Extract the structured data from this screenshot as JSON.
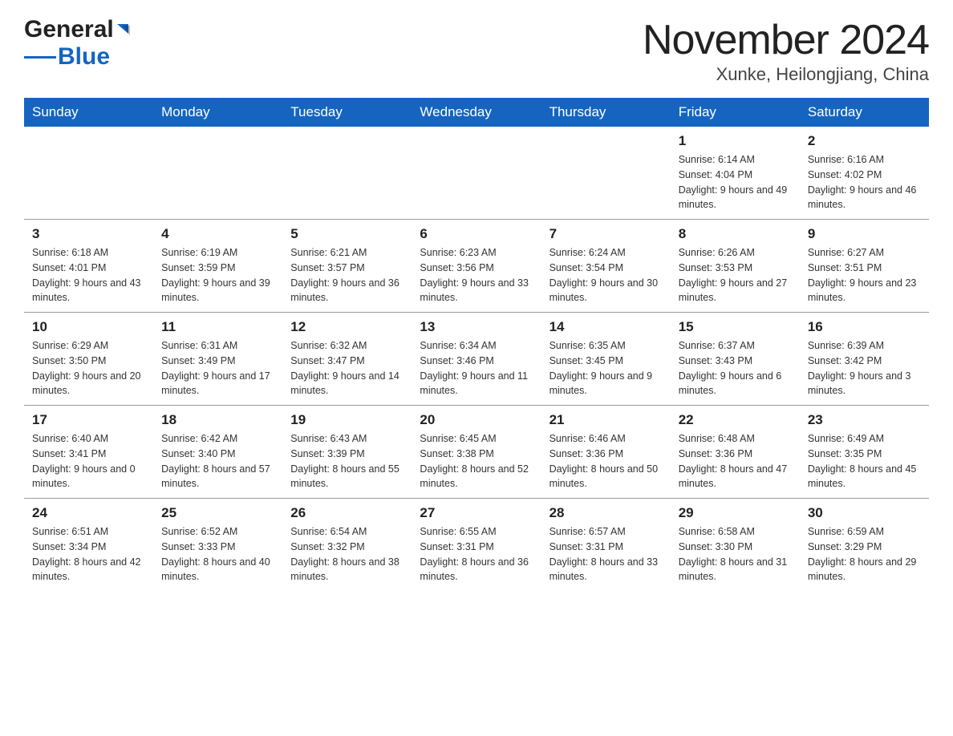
{
  "header": {
    "logo_general": "General",
    "logo_blue": "Blue",
    "title": "November 2024",
    "subtitle": "Xunke, Heilongjiang, China"
  },
  "days_of_week": [
    "Sunday",
    "Monday",
    "Tuesday",
    "Wednesday",
    "Thursday",
    "Friday",
    "Saturday"
  ],
  "weeks": [
    {
      "days": [
        {
          "num": "",
          "info": ""
        },
        {
          "num": "",
          "info": ""
        },
        {
          "num": "",
          "info": ""
        },
        {
          "num": "",
          "info": ""
        },
        {
          "num": "",
          "info": ""
        },
        {
          "num": "1",
          "info": "Sunrise: 6:14 AM\nSunset: 4:04 PM\nDaylight: 9 hours and 49 minutes."
        },
        {
          "num": "2",
          "info": "Sunrise: 6:16 AM\nSunset: 4:02 PM\nDaylight: 9 hours and 46 minutes."
        }
      ]
    },
    {
      "days": [
        {
          "num": "3",
          "info": "Sunrise: 6:18 AM\nSunset: 4:01 PM\nDaylight: 9 hours and 43 minutes."
        },
        {
          "num": "4",
          "info": "Sunrise: 6:19 AM\nSunset: 3:59 PM\nDaylight: 9 hours and 39 minutes."
        },
        {
          "num": "5",
          "info": "Sunrise: 6:21 AM\nSunset: 3:57 PM\nDaylight: 9 hours and 36 minutes."
        },
        {
          "num": "6",
          "info": "Sunrise: 6:23 AM\nSunset: 3:56 PM\nDaylight: 9 hours and 33 minutes."
        },
        {
          "num": "7",
          "info": "Sunrise: 6:24 AM\nSunset: 3:54 PM\nDaylight: 9 hours and 30 minutes."
        },
        {
          "num": "8",
          "info": "Sunrise: 6:26 AM\nSunset: 3:53 PM\nDaylight: 9 hours and 27 minutes."
        },
        {
          "num": "9",
          "info": "Sunrise: 6:27 AM\nSunset: 3:51 PM\nDaylight: 9 hours and 23 minutes."
        }
      ]
    },
    {
      "days": [
        {
          "num": "10",
          "info": "Sunrise: 6:29 AM\nSunset: 3:50 PM\nDaylight: 9 hours and 20 minutes."
        },
        {
          "num": "11",
          "info": "Sunrise: 6:31 AM\nSunset: 3:49 PM\nDaylight: 9 hours and 17 minutes."
        },
        {
          "num": "12",
          "info": "Sunrise: 6:32 AM\nSunset: 3:47 PM\nDaylight: 9 hours and 14 minutes."
        },
        {
          "num": "13",
          "info": "Sunrise: 6:34 AM\nSunset: 3:46 PM\nDaylight: 9 hours and 11 minutes."
        },
        {
          "num": "14",
          "info": "Sunrise: 6:35 AM\nSunset: 3:45 PM\nDaylight: 9 hours and 9 minutes."
        },
        {
          "num": "15",
          "info": "Sunrise: 6:37 AM\nSunset: 3:43 PM\nDaylight: 9 hours and 6 minutes."
        },
        {
          "num": "16",
          "info": "Sunrise: 6:39 AM\nSunset: 3:42 PM\nDaylight: 9 hours and 3 minutes."
        }
      ]
    },
    {
      "days": [
        {
          "num": "17",
          "info": "Sunrise: 6:40 AM\nSunset: 3:41 PM\nDaylight: 9 hours and 0 minutes."
        },
        {
          "num": "18",
          "info": "Sunrise: 6:42 AM\nSunset: 3:40 PM\nDaylight: 8 hours and 57 minutes."
        },
        {
          "num": "19",
          "info": "Sunrise: 6:43 AM\nSunset: 3:39 PM\nDaylight: 8 hours and 55 minutes."
        },
        {
          "num": "20",
          "info": "Sunrise: 6:45 AM\nSunset: 3:38 PM\nDaylight: 8 hours and 52 minutes."
        },
        {
          "num": "21",
          "info": "Sunrise: 6:46 AM\nSunset: 3:36 PM\nDaylight: 8 hours and 50 minutes."
        },
        {
          "num": "22",
          "info": "Sunrise: 6:48 AM\nSunset: 3:36 PM\nDaylight: 8 hours and 47 minutes."
        },
        {
          "num": "23",
          "info": "Sunrise: 6:49 AM\nSunset: 3:35 PM\nDaylight: 8 hours and 45 minutes."
        }
      ]
    },
    {
      "days": [
        {
          "num": "24",
          "info": "Sunrise: 6:51 AM\nSunset: 3:34 PM\nDaylight: 8 hours and 42 minutes."
        },
        {
          "num": "25",
          "info": "Sunrise: 6:52 AM\nSunset: 3:33 PM\nDaylight: 8 hours and 40 minutes."
        },
        {
          "num": "26",
          "info": "Sunrise: 6:54 AM\nSunset: 3:32 PM\nDaylight: 8 hours and 38 minutes."
        },
        {
          "num": "27",
          "info": "Sunrise: 6:55 AM\nSunset: 3:31 PM\nDaylight: 8 hours and 36 minutes."
        },
        {
          "num": "28",
          "info": "Sunrise: 6:57 AM\nSunset: 3:31 PM\nDaylight: 8 hours and 33 minutes."
        },
        {
          "num": "29",
          "info": "Sunrise: 6:58 AM\nSunset: 3:30 PM\nDaylight: 8 hours and 31 minutes."
        },
        {
          "num": "30",
          "info": "Sunrise: 6:59 AM\nSunset: 3:29 PM\nDaylight: 8 hours and 29 minutes."
        }
      ]
    }
  ]
}
